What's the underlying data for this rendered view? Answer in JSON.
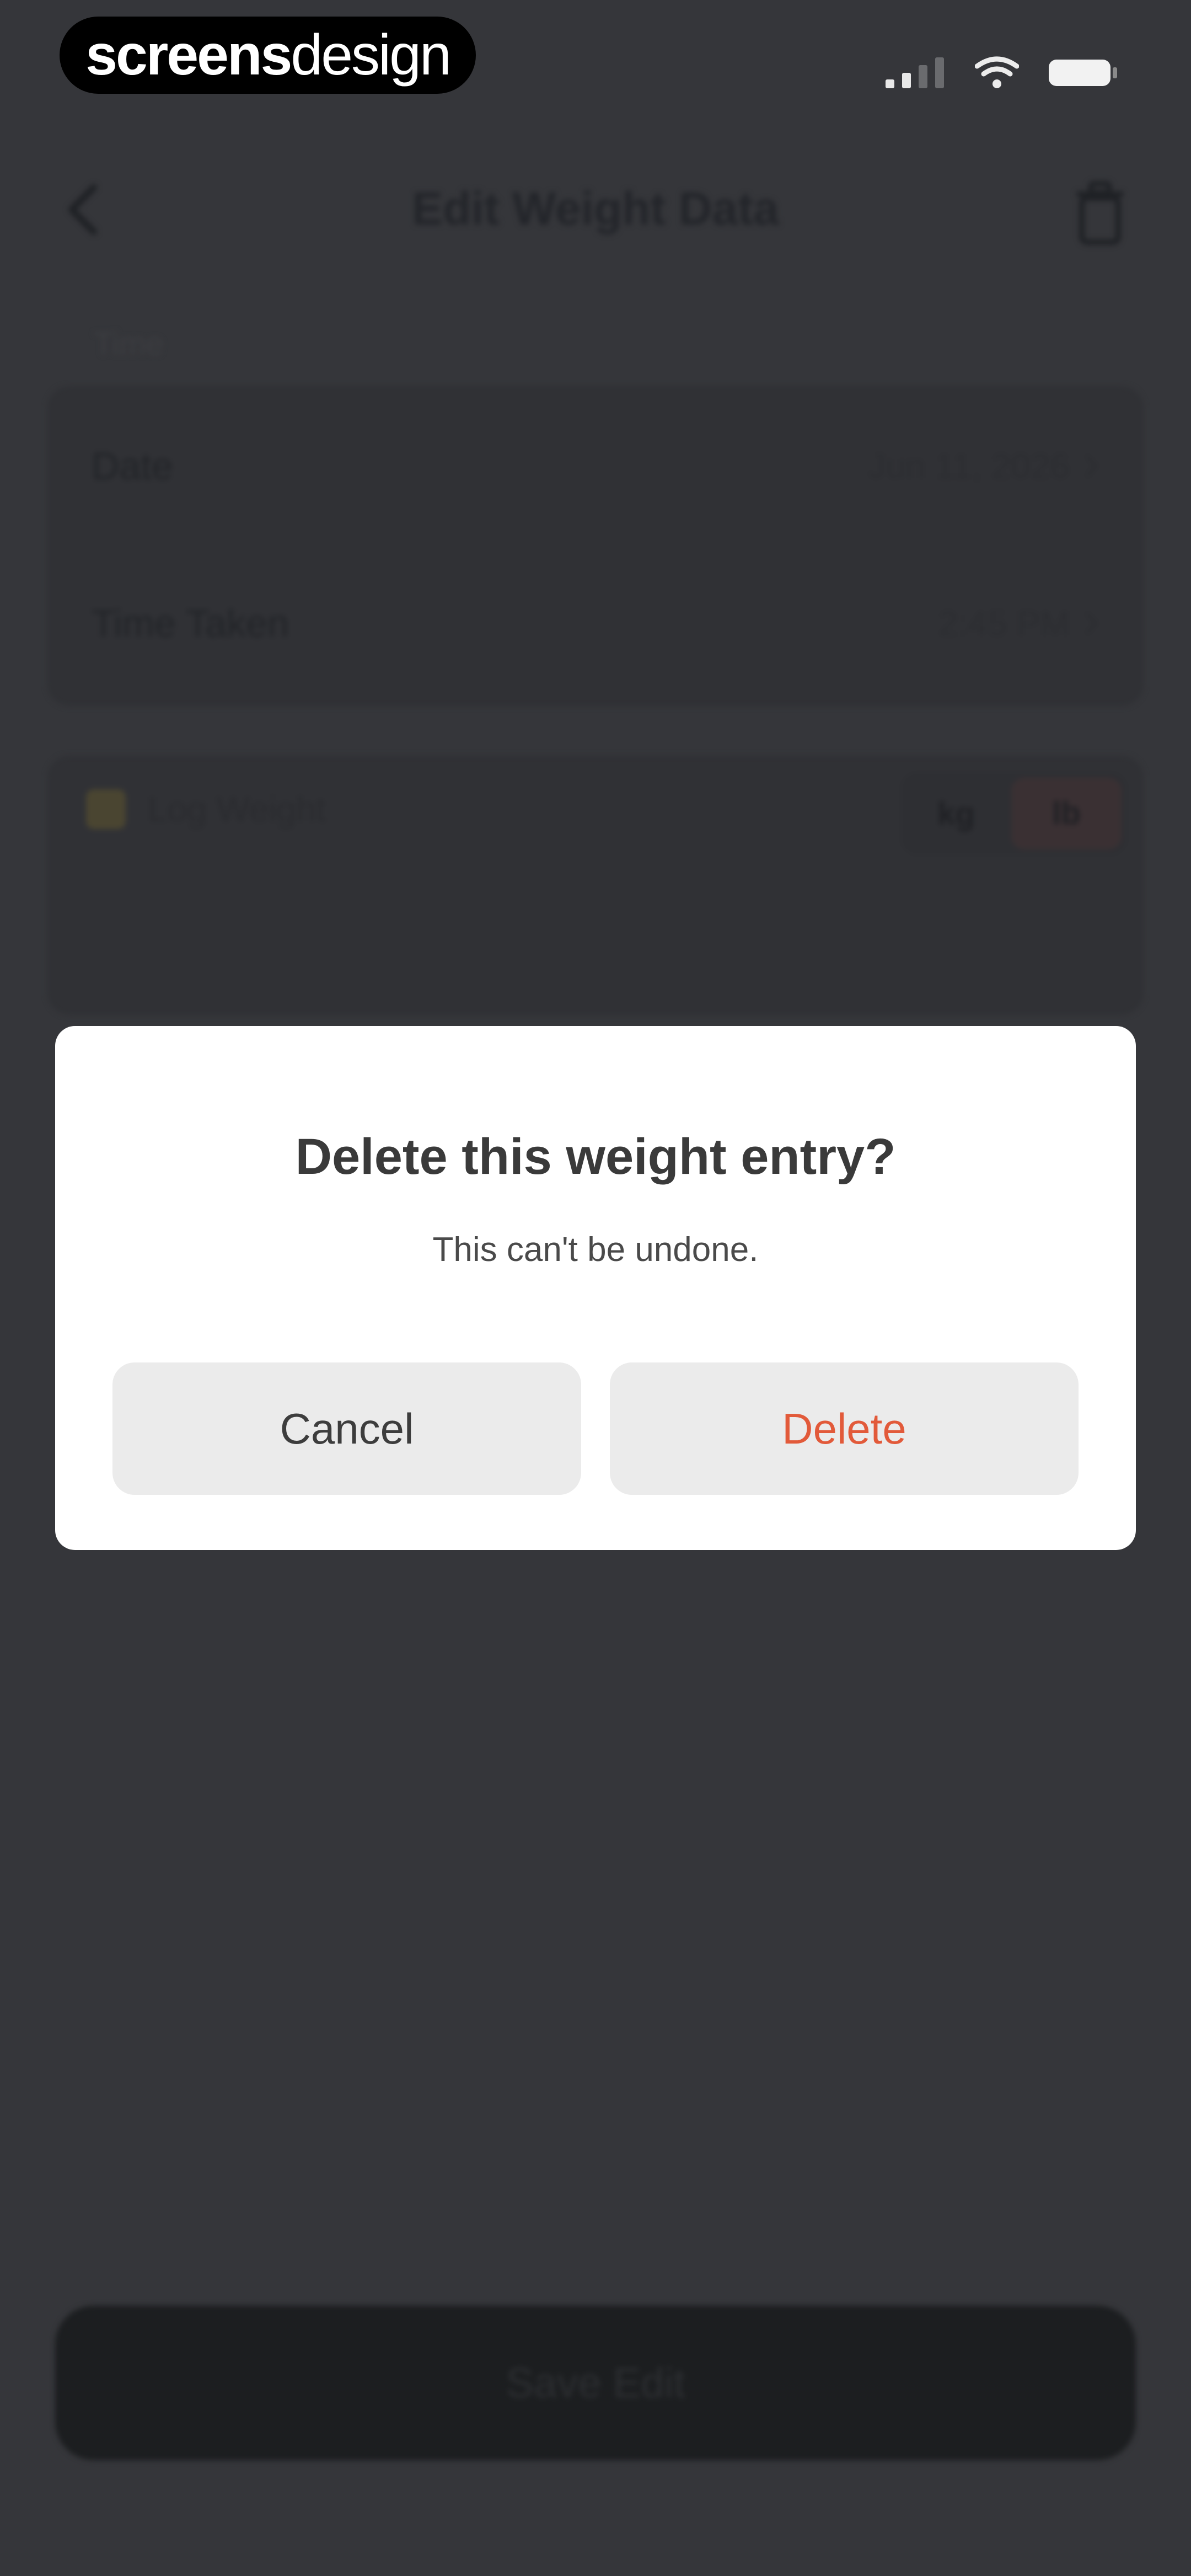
{
  "status_bar": {
    "brand_bold": "screens",
    "brand_light": "design",
    "icons": [
      "signal-icon",
      "wifi-icon",
      "battery-icon"
    ]
  },
  "header": {
    "title": "Edit Weight Data",
    "back_icon": "chevron-left-icon",
    "trash_icon": "trash-icon"
  },
  "time_section": {
    "label": "Time",
    "rows": [
      {
        "label": "Date",
        "value": "Jun 11, 2026"
      },
      {
        "label": "Time Taken",
        "value": "2:45 PM"
      }
    ]
  },
  "weight_section": {
    "label": "Log Weight",
    "units": [
      "kg",
      "lb"
    ],
    "selected_unit": "lb"
  },
  "footer": {
    "save_label": "Save Edit"
  },
  "dialog": {
    "title": "Delete this weight entry?",
    "message": "This can't be undone.",
    "cancel_label": "Cancel",
    "delete_label": "Delete"
  },
  "colors": {
    "background": "#35363a",
    "dialog": "#ffffff",
    "destructive": "#e25a3a",
    "button_bg": "#ebebeb"
  }
}
